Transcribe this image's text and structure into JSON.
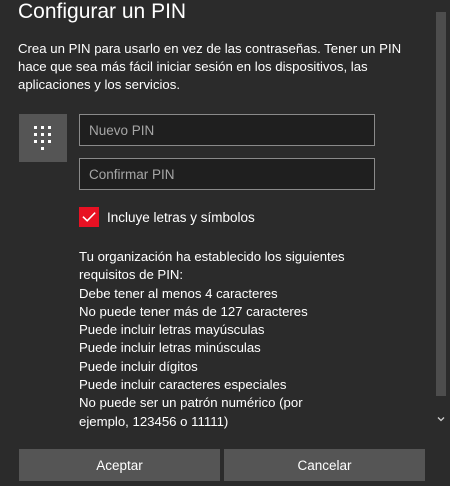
{
  "dialog": {
    "title": "Configurar un PIN",
    "description": "Crea un PIN para usarlo en vez de las contraseñas. Tener un PIN hace que sea más fácil iniciar sesión en los dispositivos, las aplicaciones y los servicios.",
    "icon": "keypad-icon"
  },
  "fields": {
    "new_pin_placeholder": "Nuevo PIN",
    "new_pin_value": "",
    "confirm_pin_placeholder": "Confirmar PIN",
    "confirm_pin_value": ""
  },
  "checkbox": {
    "label": "Incluye letras y símbolos",
    "checked": true
  },
  "requirements": {
    "lines": [
      "Tu organización ha establecido los siguientes",
      "requisitos de PIN:",
      "Debe tener al menos 4 caracteres",
      "No puede tener más de 127 caracteres",
      "Puede incluir letras mayúsculas",
      "Puede incluir letras minúsculas",
      "Puede incluir dígitos",
      "Puede incluir caracteres especiales",
      "No puede ser un patrón numérico (por",
      "ejemplo, 123456 o 11111)"
    ]
  },
  "buttons": {
    "accept": "Aceptar",
    "cancel": "Cancelar"
  },
  "colors": {
    "background": "#2b2b2b",
    "accent": "#e81123",
    "button": "#555555",
    "field_border": "#8a8a8a"
  }
}
